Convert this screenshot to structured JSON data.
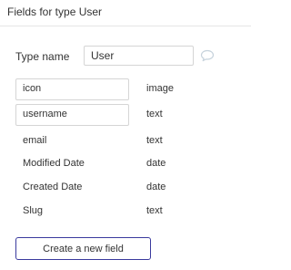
{
  "panel": {
    "title": "Fields for type User"
  },
  "type_name": {
    "label": "Type name",
    "value": "User",
    "comment_icon": "comment-bubble-icon"
  },
  "fields": [
    {
      "name": "icon",
      "type": "image",
      "boxed": true
    },
    {
      "name": "username",
      "type": "text",
      "boxed": true
    },
    {
      "name": "email",
      "type": "text",
      "boxed": false
    },
    {
      "name": "Modified Date",
      "type": "date",
      "boxed": false
    },
    {
      "name": "Created Date",
      "type": "date",
      "boxed": false
    },
    {
      "name": "Slug",
      "type": "text",
      "boxed": false
    }
  ],
  "actions": {
    "create_field_label": "Create a new field"
  },
  "colors": {
    "button_border": "#3a3a9e",
    "input_border": "#d5d5d5",
    "divider": "#e6e6e6",
    "icon": "#c7d3dc"
  }
}
